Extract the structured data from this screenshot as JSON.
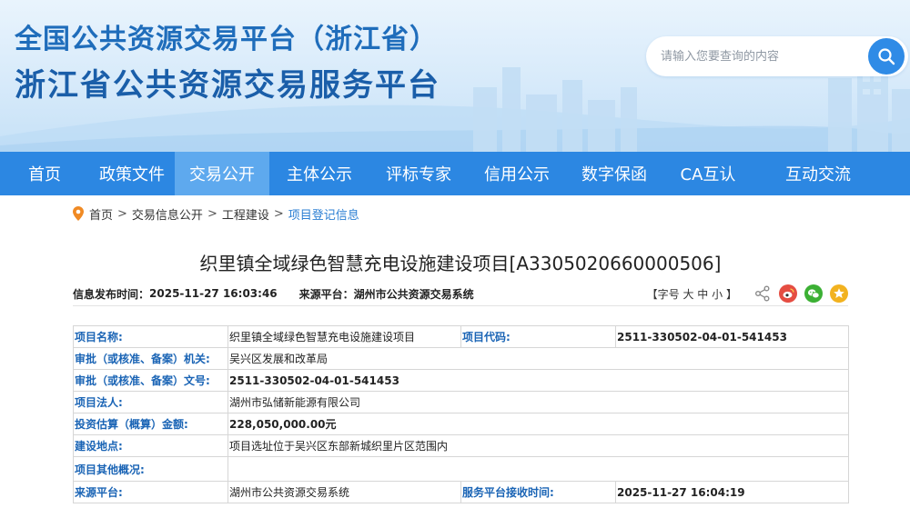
{
  "header": {
    "title_line1": "全国公共资源交易平台（浙江省）",
    "title_line2": "浙江省公共资源交易服务平台",
    "search_placeholder": "请输入您要查询的内容"
  },
  "nav": {
    "items": [
      {
        "label": "首页"
      },
      {
        "label": "政策文件"
      },
      {
        "label": "交易公开"
      },
      {
        "label": "主体公示"
      },
      {
        "label": "评标专家"
      },
      {
        "label": "信用公示"
      },
      {
        "label": "数字保函"
      },
      {
        "label": "CA互认"
      },
      {
        "label": "互动交流"
      }
    ],
    "active": "交易公开"
  },
  "breadcrumb": {
    "items": [
      "首页",
      "交易信息公开",
      "工程建设"
    ],
    "current": "项目登记信息",
    "separator": ">"
  },
  "article": {
    "title": "织里镇全域绿色智慧充电设施建设项目[A3305020660000506]",
    "publish_label": "信息发布时间：",
    "publish_time": "2025-11-27 16:03:46",
    "source_label": "来源平台：",
    "source": "湖州市公共资源交易系统",
    "fontsize_prefix": "【字号",
    "fontsize_large": "大",
    "fontsize_medium": "中",
    "fontsize_small": "小",
    "fontsize_suffix": "】"
  },
  "icons": {
    "share": "share-icon",
    "weibo": "weibo-icon",
    "wechat": "wechat-icon",
    "favorite": "star-icon"
  },
  "colors": {
    "nav_bg": "#2c87e2",
    "nav_active": "#5ea9ee",
    "title_blue": "#1f6dbb",
    "label_blue": "#1a64b5",
    "search_button": "#2f8be6"
  },
  "table": {
    "rows": [
      [
        {
          "label": "项目名称:",
          "value": "织里镇全域绿色智慧充电设施建设项目"
        },
        {
          "label": "项目代码:",
          "value": "2511-330502-04-01-541453"
        }
      ],
      [
        {
          "label": "审批（或核准、备案）机关:",
          "value": "吴兴区发展和改革局"
        }
      ],
      [
        {
          "label": "审批（或核准、备案）文号:",
          "value": "2511-330502-04-01-541453"
        }
      ],
      [
        {
          "label": "项目法人:",
          "value": "湖州市弘储新能源有限公司"
        }
      ],
      [
        {
          "label": "投资估算（概算）金额:",
          "value": "228,050,000.00元"
        }
      ],
      [
        {
          "label": "建设地点:",
          "value": "项目选址位于吴兴区东部新城织里片区范围内"
        }
      ],
      [
        {
          "label": "项目其他概况:",
          "value": ""
        }
      ],
      [
        {
          "label": "来源平台:",
          "value": "湖州市公共资源交易系统"
        },
        {
          "label": "服务平台接收时间:",
          "value": "2025-11-27 16:04:19"
        }
      ]
    ]
  }
}
